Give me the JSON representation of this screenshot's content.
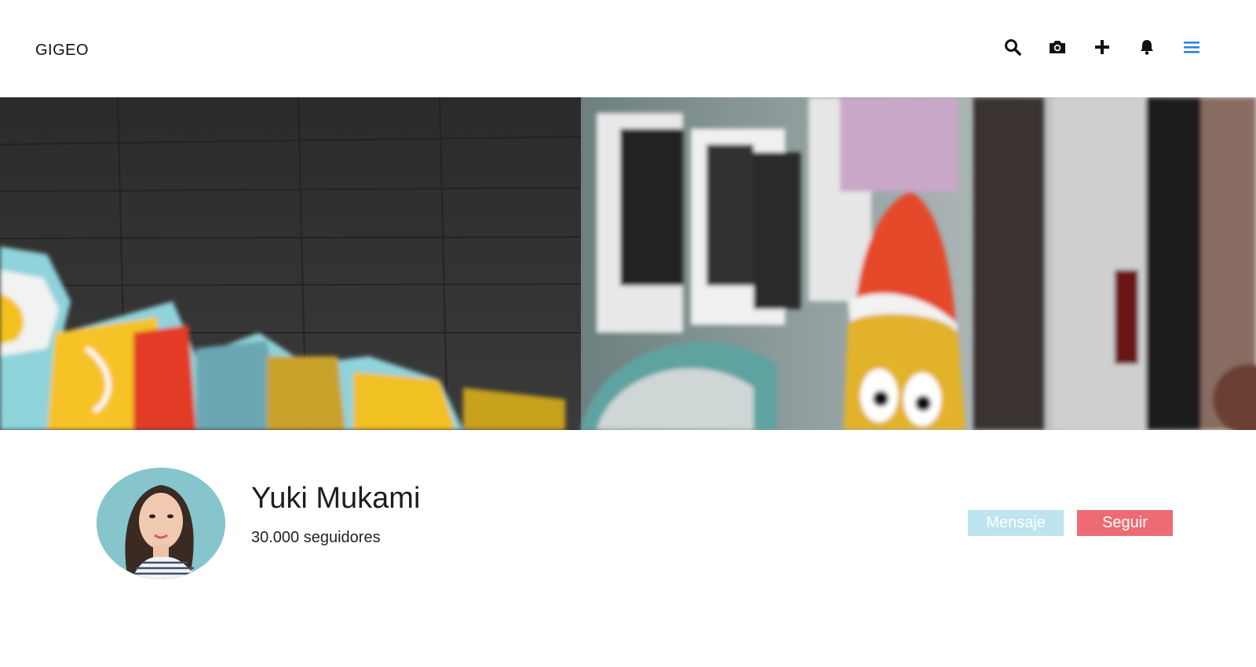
{
  "header": {
    "brand": "GIGEO",
    "icons": [
      {
        "name": "search-icon"
      },
      {
        "name": "camera-icon"
      },
      {
        "name": "plus-icon"
      },
      {
        "name": "bell-icon"
      },
      {
        "name": "menu-icon"
      }
    ],
    "menu_icon_color": "#2d83d6"
  },
  "banner": {
    "description_icon": "graffiti-banner-image"
  },
  "profile": {
    "name": "Yuki Mukami",
    "followers": "30.000 seguidores",
    "message_label": "Mensaje",
    "follow_label": "Seguir",
    "message_color": "#bde4ef",
    "follow_color": "#ee6b73"
  }
}
